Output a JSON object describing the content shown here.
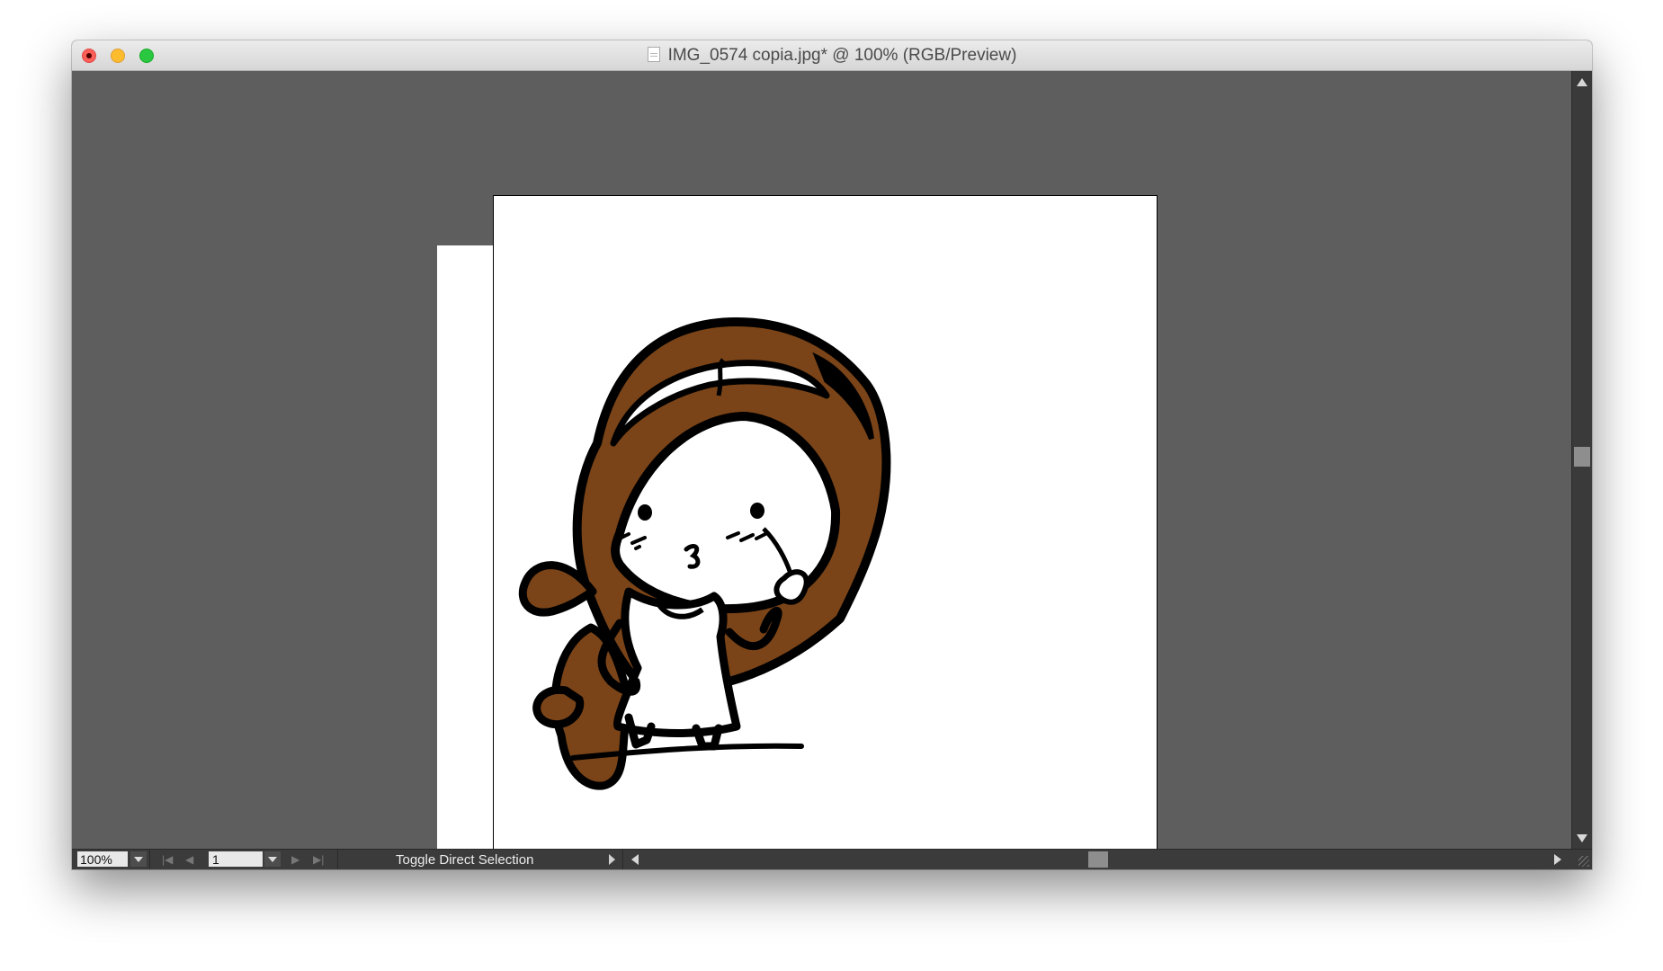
{
  "window": {
    "title": "IMG_0574 copia.jpg* @ 100% (RGB/Preview)"
  },
  "statusbar": {
    "zoom_value": "100%",
    "page_value": "1",
    "status_text": "Toggle Direct Selection"
  },
  "icons": {
    "close": "close-icon",
    "minimize": "minimize-icon",
    "maximize": "maximize-icon",
    "document": "document-icon",
    "chevron_down": "chevron-down-icon",
    "first_page": "first-page-icon",
    "prev_page": "prev-page-icon",
    "next_page": "next-page-icon",
    "last_page": "last-page-icon",
    "scroll_up": "scroll-up-icon",
    "scroll_down": "scroll-down-icon",
    "scroll_left": "scroll-left-icon",
    "scroll_right": "scroll-right-icon"
  },
  "colors": {
    "canvas_background": "#5e5e5e",
    "hair": "#7a4418",
    "outline": "#000000",
    "artboard": "#ffffff"
  }
}
